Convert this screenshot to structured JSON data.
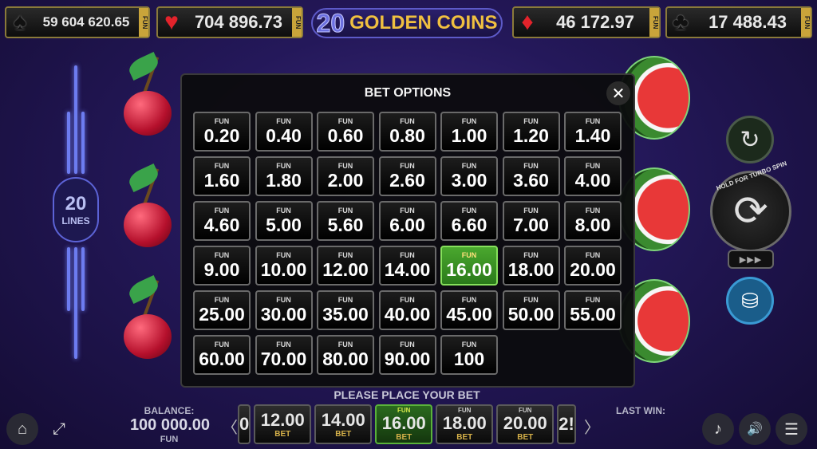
{
  "jackpots": [
    {
      "suit": "spade",
      "symbol": "♠",
      "amount": "59 604 620.65",
      "currency": "FUN"
    },
    {
      "suit": "heart",
      "symbol": "♥",
      "amount": "704 896.73",
      "currency": "FUN"
    },
    {
      "suit": "diamond",
      "symbol": "♦",
      "amount": "46 172.97",
      "currency": "FUN"
    },
    {
      "suit": "club",
      "symbol": "♣",
      "amount": "17 488.43",
      "currency": "FUN"
    }
  ],
  "logo": {
    "number": "20",
    "text": "GOLDEN COINS"
  },
  "lines": {
    "count": "20",
    "label": "LINES"
  },
  "modal": {
    "title": "BET OPTIONS",
    "close_icon": "✕",
    "currency": "FUN",
    "selected": "16.00",
    "options": [
      "0.20",
      "0.40",
      "0.60",
      "0.80",
      "1.00",
      "1.20",
      "1.40",
      "1.60",
      "1.80",
      "2.00",
      "2.60",
      "3.00",
      "3.60",
      "4.00",
      "4.60",
      "5.00",
      "5.60",
      "6.00",
      "6.60",
      "7.00",
      "8.00",
      "9.00",
      "10.00",
      "12.00",
      "14.00",
      "16.00",
      "18.00",
      "20.00",
      "25.00",
      "30.00",
      "35.00",
      "40.00",
      "45.00",
      "50.00",
      "55.00",
      "60.00",
      "70.00",
      "80.00",
      "90.00",
      "100"
    ]
  },
  "controls": {
    "spin_label": "HOLD FOR TURBO SPIN",
    "turbo_label": "▶▶▶"
  },
  "bottom": {
    "place_bet": "PLEASE PLACE YOUR BET",
    "balance_label": "BALANCE:",
    "balance_value": "100 000.00",
    "balance_currency": "FUN",
    "last_win_label": "LAST WIN:",
    "prev_arrow": "〈",
    "next_arrow": "〉",
    "strip": [
      {
        "value": "0",
        "partial": true
      },
      {
        "value": "12.00",
        "label": "BET"
      },
      {
        "value": "14.00",
        "label": "BET"
      },
      {
        "value": "16.00",
        "label": "BET",
        "currency": "FUN",
        "selected": true
      },
      {
        "value": "18.00",
        "label": "BET",
        "currency": "FUN"
      },
      {
        "value": "20.00",
        "label": "BET",
        "currency": "FUN"
      },
      {
        "value": "2!",
        "partial": true
      }
    ]
  },
  "icons": {
    "home": "⌂",
    "fullscreen": "⤢",
    "music": "♪",
    "sound": "🔊",
    "menu": "☰",
    "autoplay": "↻",
    "spin": "⟳",
    "coins": "⛁"
  }
}
